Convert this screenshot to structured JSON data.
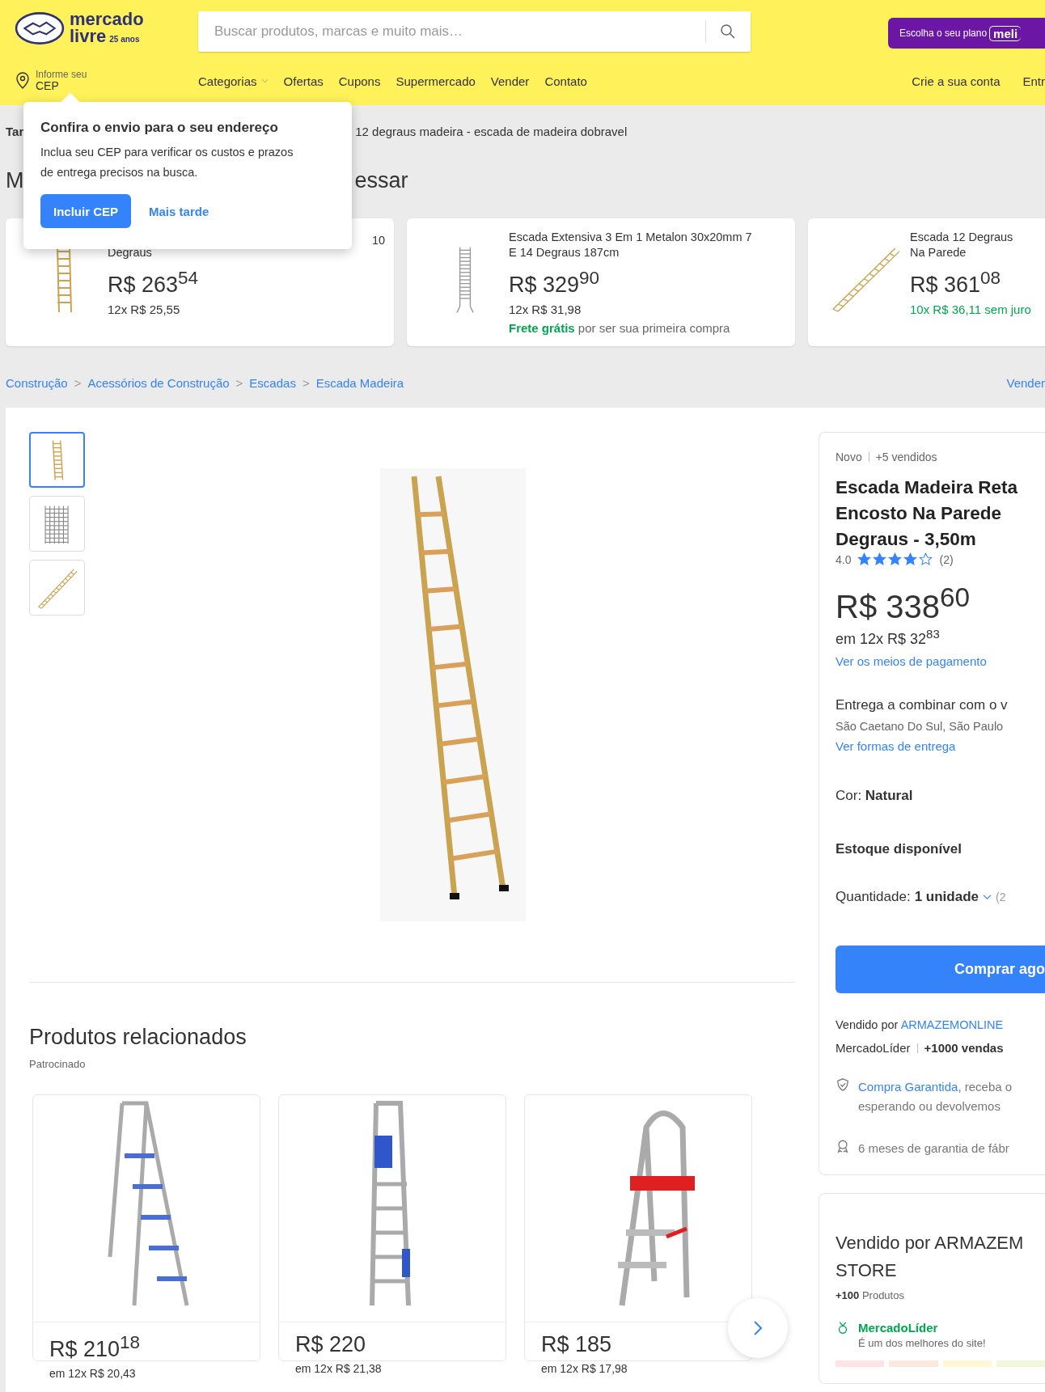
{
  "header": {
    "logo": {
      "line1": "mercado",
      "line2": "livre",
      "badge": "25 anos"
    },
    "search": {
      "placeholder": "Buscar produtos, marcas e muito mais…"
    },
    "plan_promo": {
      "label": "Escolha o seu plano",
      "badge": "meli"
    },
    "location": {
      "line1": "Informe seu",
      "line2": "CEP"
    },
    "nav": [
      {
        "label": "Categorias",
        "kind": "dropdown"
      },
      {
        "label": "Ofertas",
        "kind": "link"
      },
      {
        "label": "Cupons",
        "kind": "link"
      },
      {
        "label": "Supermercado",
        "kind": "link"
      },
      {
        "label": "Vender",
        "kind": "link"
      },
      {
        "label": "Contato",
        "kind": "link"
      }
    ],
    "account_links": [
      "Crie a sua conta",
      "Entr"
    ]
  },
  "popup": {
    "title": "Confira o envio para o seu endereço",
    "text": "Inclua seu CEP para verificar os custos e prazos de entrega precisos na busca.",
    "primary_button": "Incluir CEP",
    "secondary_button": "Mais tarde"
  },
  "related_searches": {
    "label": "Tar",
    "text": "12 degraus madeira - escada de madeira dobravel"
  },
  "interest": {
    "heading_start": "M",
    "heading_end": "essar",
    "cards": [
      {
        "kind": "straight",
        "title_lines": [
          "10",
          "Degraus"
        ],
        "price": "R$ 263$^{54}$",
        "installments": "12x R$ 25,55",
        "interest_free": false
      },
      {
        "kind": "extension",
        "title_lines": [
          "Escada Extensiva 3 Em 1 Metalon 30x20mm 7",
          "E 14 Degraus 187cm"
        ],
        "price": "R$ 329$^{90}$",
        "installments": "12x R$ 31,98",
        "interest_free": false,
        "shipping": {
          "highlight": "Frete grátis",
          "rest": "por ser sua primeira compra"
        }
      },
      {
        "kind": "diagonal",
        "title_lines": [
          "Escada 12 Degraus",
          "Na Parede"
        ],
        "price": "R$ 361$^{08}$",
        "installments": "10x R$ 36,11 sem juro",
        "interest_free": true
      }
    ]
  },
  "breadcrumb": {
    "separator": ">",
    "items": [
      "Construção",
      "Acessórios de Construção",
      "Escadas",
      "Escada Madeira"
    ],
    "action": "Vender"
  },
  "gallery": {
    "thumbnails": [
      {
        "kind": "straight",
        "selected": true
      },
      {
        "kind": "stack",
        "selected": false
      },
      {
        "kind": "diagonal",
        "selected": false
      }
    ]
  },
  "product": {
    "condition": "Novo",
    "sold": "+5 vendidos",
    "title_lines": [
      "Escada Madeira Reta",
      "Encosto Na Parede",
      "Degraus - 3,50m"
    ],
    "rating": "4.0",
    "stars": 4,
    "reviews": "(2)",
    "price": "R$ 338$^{60}$",
    "installments": "em 12x R$ 32$^{83}$",
    "payment_link": "Ver os meios de pagamento",
    "delivery": "Entrega a combinar com o v",
    "location": "São Caetano Do Sul, São Paulo",
    "delivery_link": "Ver formas de entrega",
    "color_label": "Cor:",
    "color_value": "Natural",
    "stock": "Estoque disponível",
    "quantity_label": "Quantidade:",
    "quantity_value": "1 unidade",
    "quantity_note": "(2",
    "buy_button": "Comprar ago",
    "seller_prefix": "Vendido por",
    "seller_name": "ARMAZEMONLINE",
    "seller_badge": "MercadoLíder",
    "seller_sales": "+1000 vendas",
    "benefits": [
      {
        "kind": "shield",
        "link": "Compra Garantida",
        "text": ", receba o",
        "line2": "esperando ou devolvemos"
      },
      {
        "kind": "medal",
        "text": "6 meses de garantia de fábr"
      }
    ]
  },
  "seller": {
    "title_lines": [
      "Vendido por ARMAZEM",
      "STORE"
    ],
    "products_count": "+100",
    "products_label": "Produtos",
    "badge": "MercadoLíder",
    "badge_note": "É um dos melhores do site!"
  },
  "related": {
    "title": "Produtos relacionados",
    "sponsored": "Patrocinado",
    "items": [
      {
        "kind": "blue-steps",
        "price": "R$ 210$^{18}$",
        "installments": "em 12x R$ 20,43"
      },
      {
        "kind": "blue-folded",
        "price": "R$ 220",
        "installments": "em 12x R$ 21,38"
      },
      {
        "kind": "red-steps",
        "price": "R$ 185",
        "installments": "em 12x R$ 17,98"
      }
    ]
  }
}
